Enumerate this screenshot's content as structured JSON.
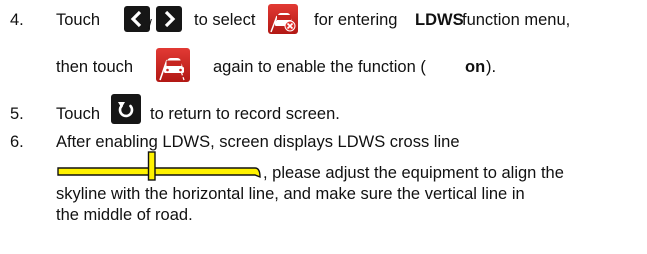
{
  "steps": [
    {
      "number": "4.",
      "line1": {
        "touch": "Touch",
        "slash": "/",
        "to_select": "to select",
        "for_entering": "for entering",
        "ldws": "LDWS",
        "function_menu": "function menu,"
      },
      "line2": {
        "then_touch": "then touch",
        "again": "again to enable the function (",
        "on": "on",
        "close": ")."
      }
    },
    {
      "number": "5.",
      "touch": "Touch",
      "text": "to return to record screen."
    },
    {
      "number": "6.",
      "line1": "After enabling LDWS, screen displays LDWS cross line",
      "line2": ", please adjust the equipment to align the",
      "line3": "skyline with the horizontal line, and make sure the vertical line in",
      "line4": "the middle of road."
    }
  ],
  "icons": {
    "left": "chevron-left-icon",
    "right": "chevron-right-icon",
    "ldws_off": "ldws-car-off-icon",
    "ldws_on": "ldws-car-icon",
    "return": "return-icon",
    "crossline": "ldws-cross-line-icon"
  },
  "colors": {
    "icon_red": "#cc2a25",
    "icon_dark": "#161616",
    "crossline_yellow": "#fff200"
  }
}
